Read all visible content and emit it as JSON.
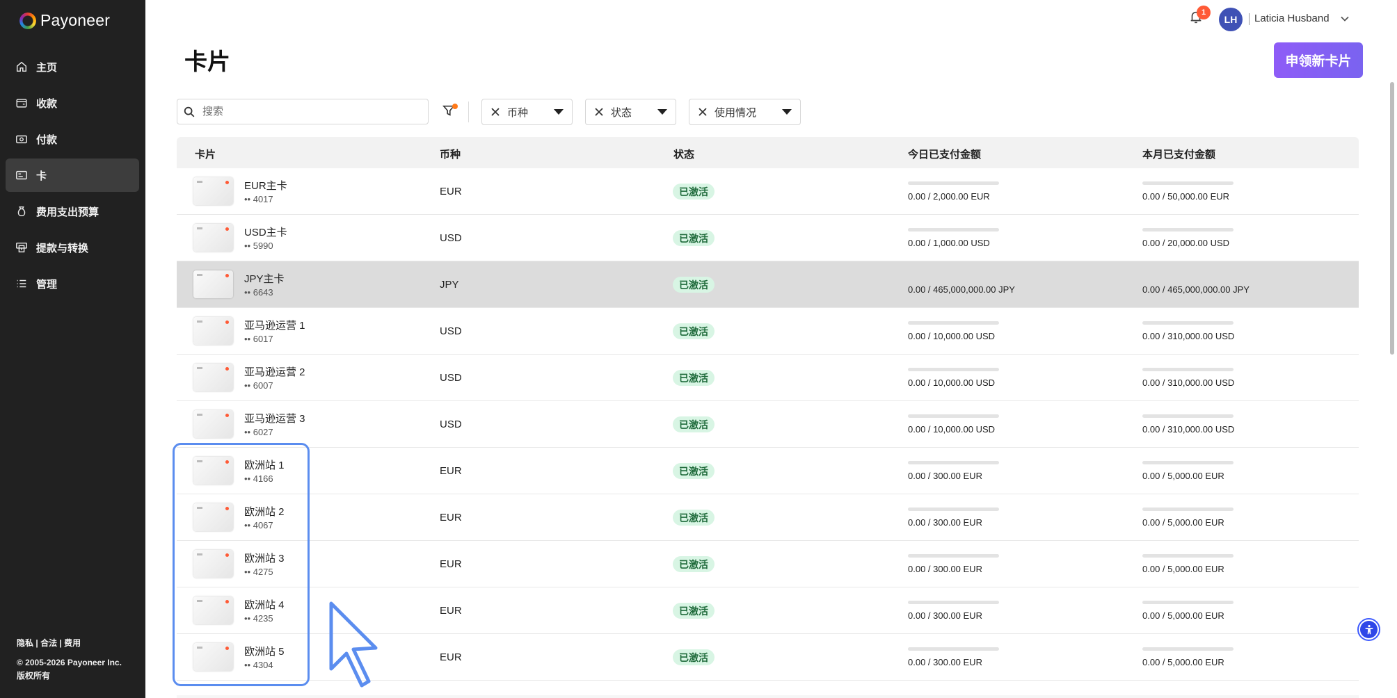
{
  "app": {
    "brand": "Payoneer"
  },
  "sidebar": {
    "items": [
      {
        "label": "主页",
        "icon": "home-icon"
      },
      {
        "label": "收款",
        "icon": "wallet-icon"
      },
      {
        "label": "付款",
        "icon": "money-icon"
      },
      {
        "label": "卡",
        "icon": "card-icon",
        "active": true
      },
      {
        "label": "费用支出预算",
        "icon": "money-bag-icon"
      },
      {
        "label": "提款与转换",
        "icon": "withdraw-icon"
      },
      {
        "label": "管理",
        "icon": "list-icon"
      }
    ],
    "footer": {
      "privacy": "隐私",
      "legal": "合法",
      "fees": "费用",
      "sep": "|",
      "copyright": "© 2005-2026 Payoneer Inc.",
      "rights": "版权所有"
    }
  },
  "topbar": {
    "notification_count": "1",
    "avatar_initials": "LH",
    "user_name": "Laticia Husband"
  },
  "page": {
    "title": "卡片",
    "apply_button": "申领新卡片"
  },
  "filters": {
    "search_placeholder": "搜索",
    "chips": [
      "币种",
      "状态",
      "使用情况"
    ]
  },
  "table": {
    "columns": [
      "卡片",
      "币种",
      "状态",
      "今日已支付金额",
      "本月已支付金额"
    ],
    "rows": [
      {
        "name": "EUR主卡",
        "num": "•• 4017",
        "currency": "EUR",
        "status": "已激活",
        "today": "0.00 / 2,000.00 EUR",
        "month": "0.00 / 50,000.00 EUR"
      },
      {
        "name": "USD主卡",
        "num": "•• 5990",
        "currency": "USD",
        "status": "已激活",
        "today": "0.00 / 1,000.00 USD",
        "month": "0.00 / 20,000.00 USD"
      },
      {
        "name": "JPY主卡",
        "num": "•• 6643",
        "currency": "JPY",
        "status": "已激活",
        "today": "0.00 / 465,000,000.00 JPY",
        "month": "0.00 / 465,000,000.00 JPY"
      },
      {
        "name": "亚马逊运营 1",
        "num": "•• 6017",
        "currency": "USD",
        "status": "已激活",
        "today": "0.00 / 10,000.00 USD",
        "month": "0.00 / 310,000.00 USD"
      },
      {
        "name": "亚马逊运营 2",
        "num": "•• 6007",
        "currency": "USD",
        "status": "已激活",
        "today": "0.00 / 10,000.00 USD",
        "month": "0.00 / 310,000.00 USD"
      },
      {
        "name": "亚马逊运营 3",
        "num": "•• 6027",
        "currency": "USD",
        "status": "已激活",
        "today": "0.00 / 10,000.00 USD",
        "month": "0.00 / 310,000.00 USD"
      },
      {
        "name": "欧洲站 1",
        "num": "•• 4166",
        "currency": "EUR",
        "status": "已激活",
        "today": "0.00 / 300.00 EUR",
        "month": "0.00 / 5,000.00 EUR"
      },
      {
        "name": "欧洲站 2",
        "num": "•• 4067",
        "currency": "EUR",
        "status": "已激活",
        "today": "0.00 / 300.00 EUR",
        "month": "0.00 / 5,000.00 EUR"
      },
      {
        "name": "欧洲站 3",
        "num": "•• 4275",
        "currency": "EUR",
        "status": "已激活",
        "today": "0.00 / 300.00 EUR",
        "month": "0.00 / 5,000.00 EUR"
      },
      {
        "name": "欧洲站 4",
        "num": "•• 4235",
        "currency": "EUR",
        "status": "已激活",
        "today": "0.00 / 300.00 EUR",
        "month": "0.00 / 5,000.00 EUR"
      },
      {
        "name": "欧洲站 5",
        "num": "•• 4304",
        "currency": "EUR",
        "status": "已激活",
        "today": "0.00 / 300.00 EUR",
        "month": "0.00 / 5,000.00 EUR"
      }
    ]
  },
  "colors": {
    "sidebar_bg": "#212121",
    "accent": "#8a5cf6",
    "status_bg": "#d8f5e4",
    "highlight_row": "#dcdcdc",
    "selection": "#5b8def"
  }
}
